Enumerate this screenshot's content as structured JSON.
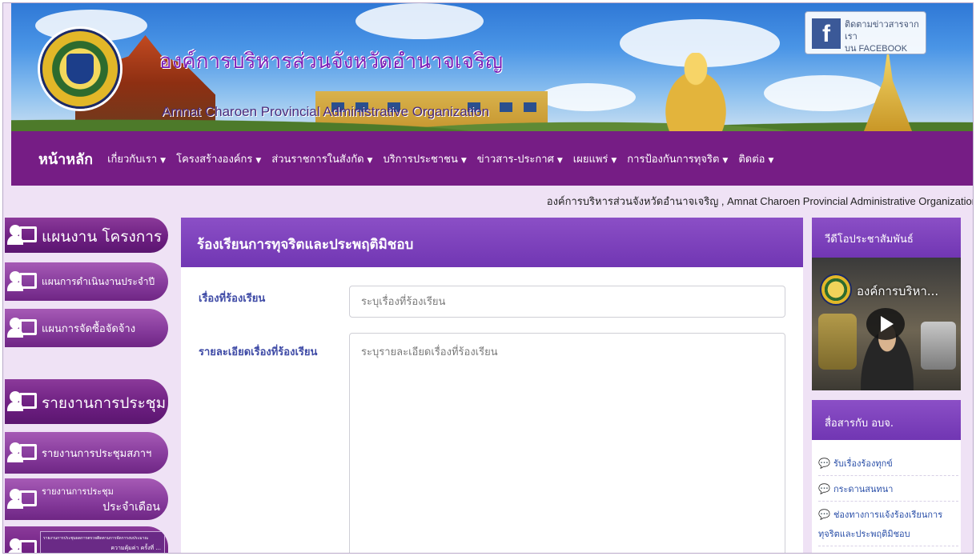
{
  "header": {
    "title_th": "องค์การบริหารส่วนจังหวัดอำนาจเจริญ",
    "title_en": "Amnat Charoen Provincial Administrative Organization",
    "facebook": {
      "line1": "ติดตามข่าวสารจากเรา",
      "line2": "บน FACEBOOK"
    }
  },
  "nav": {
    "home": "หน้าหลัก",
    "items": [
      {
        "label": "เกี่ยวกับเรา"
      },
      {
        "label": "โครงสร้างองค์กร"
      },
      {
        "label": "ส่วนราชการในสังกัด"
      },
      {
        "label": "บริการประชาชน"
      },
      {
        "label": "ข่าวสาร-ประกาศ"
      },
      {
        "label": "เผยแพร่"
      },
      {
        "label": "การป้องกันการทุจริต"
      },
      {
        "label": "ติดต่อ"
      }
    ],
    "caret": "▼"
  },
  "marquee": "องค์การบริหารส่วนจังหวัดอำนาจเจริญ , Amnat Charoen Provincial Administrative Organization",
  "left_sidebar": {
    "items": [
      {
        "label": "แผนงาน โครงการ"
      },
      {
        "label": "แผนการดำเนินงานประจำปี"
      },
      {
        "label": "แผนการจัดซื้อจัดจ้าง"
      },
      {
        "label": "รายงานการประชุม"
      },
      {
        "label": "รายงานการประชุมสภาฯ"
      },
      {
        "label": "รายงานการประชุม",
        "label2": "ประจำเดือน"
      },
      {
        "label": "รายงานการประชุมผลการตรวจติดตามการจัดการงบประมาณ",
        "label2": "ความคุ้มค่า ครั้งที่ ..."
      }
    ]
  },
  "form": {
    "title": "ร้องเรียนการทุจริตและประพฤติมิชอบ",
    "subject_label": "เรื่องที่ร้องเรียน",
    "subject_placeholder": "ระบุเรื่องที่ร้องเรียน",
    "detail_label": "รายละเอียดเรื่องที่ร้องเรียน",
    "detail_placeholder": "ระบุรายละเอียดเรื่องที่ร้องเรียน"
  },
  "right_sidebar": {
    "video_heading": "วีดีโอประชาสัมพันธ์",
    "video_title": "องค์การบริหา...",
    "comm_heading": "สื่อสารกับ อบจ.",
    "links": [
      {
        "label": "รับเรื่องร้องทุกข์"
      },
      {
        "label": "กระดานสนทนา"
      },
      {
        "label": "ช่องทางการแจ้งร้องเรียนการ"
      },
      {
        "label": "ทุจริตและประพฤติมิชอบ"
      }
    ]
  }
}
